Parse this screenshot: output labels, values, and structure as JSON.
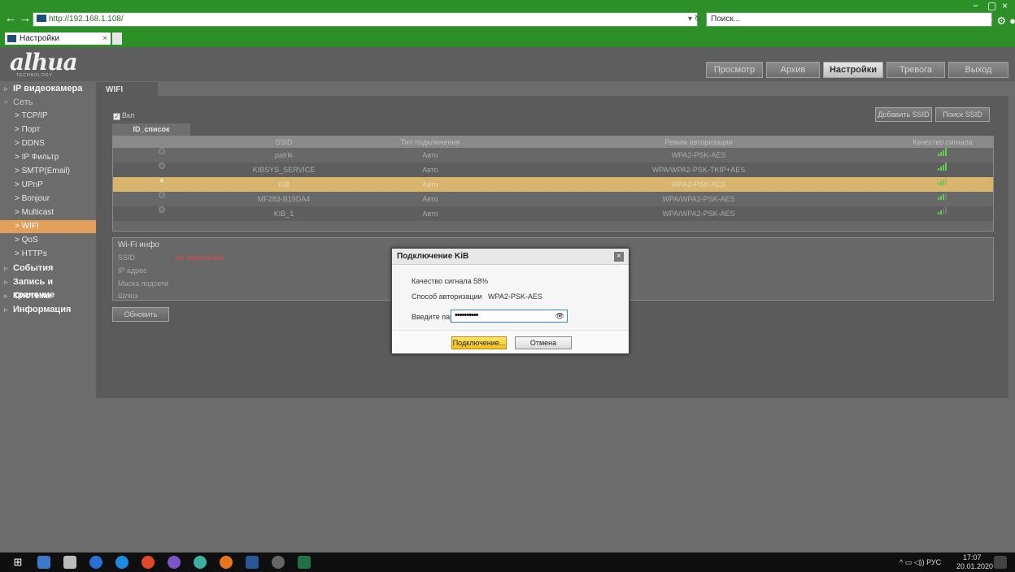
{
  "browser": {
    "url": "http://192.168.1.108/",
    "search_placeholder": "Поиск...",
    "tab_title": "Настройки",
    "tab_close": "×",
    "back_icon": "←",
    "forward_icon": "→",
    "refresh_icon": "▾ ↻",
    "search_dd_icon": "⌕▾",
    "toolbar_icons": "⌂★⚙●",
    "win_min": "−",
    "win_max": "▢",
    "win_close": "×"
  },
  "app": {
    "logo": "alhua",
    "logo_sub": "TECHNOLOGY",
    "nav": [
      {
        "label": "Просмотр"
      },
      {
        "label": "Архив"
      },
      {
        "label": "Настройки"
      },
      {
        "label": "Тревога"
      },
      {
        "label": "Выход"
      }
    ]
  },
  "sidebar": {
    "items": [
      {
        "label": "IP видеокамера"
      },
      {
        "label": "Сеть"
      },
      {
        "label": "> TCP/IP"
      },
      {
        "label": "> Порт"
      },
      {
        "label": "> DDNS"
      },
      {
        "label": "> IP Фильтр"
      },
      {
        "label": "> SMTP(Email)"
      },
      {
        "label": "> UPnP"
      },
      {
        "label": "> Bonjour"
      },
      {
        "label": "> Multicast"
      },
      {
        "label": "> WIFI"
      },
      {
        "label": "> QoS"
      },
      {
        "label": "> HTTPs"
      },
      {
        "label": "События"
      },
      {
        "label": "Запись и хранение"
      },
      {
        "label": "Система"
      },
      {
        "label": "Информация"
      }
    ]
  },
  "page": {
    "tab": "WIFI",
    "enable_label": "Вкл",
    "enable_check": "✓",
    "add_ssid": "Добавить SSID",
    "search_ssid": "Поиск SSID",
    "list_tab": "ID_список",
    "columns": [
      "SSID",
      "Тип подключения",
      "Режим авторизации",
      "Качество сигнала"
    ],
    "rows": [
      {
        "ssid": "patrik",
        "type": "Авто",
        "auth": "WPA2-PSK-AES"
      },
      {
        "ssid": "KIBSYS_SERVICE",
        "type": "Авто",
        "auth": "WPA/WPA2-PSK-TKIP+AES"
      },
      {
        "ssid": "KiB",
        "type": "Авто",
        "auth": "WPA2-PSK-AES"
      },
      {
        "ssid": "MF283-B19DA4",
        "type": "Авто",
        "auth": "WPA/WPA2-PSK-AES"
      },
      {
        "ssid": "KIB_1",
        "type": "Авто",
        "auth": "WPA/WPA2-PSK-AES"
      }
    ],
    "info": {
      "title": "Wi-Fi инфо",
      "ssid_label": "SSID",
      "ssid_value": "Не подключен",
      "ip_label": "IP адрес",
      "mask_label": "Маска подсети",
      "gw_label": "Шлюз"
    },
    "refresh": "Обновить"
  },
  "dialog": {
    "title": "Подключение KiB",
    "close": "×",
    "signal_label": "Качество сигнала",
    "signal_value": "58%",
    "auth_label": "Способ авторизации",
    "auth_value": "WPA2-PSK-AES",
    "password_label": "Введите пароль",
    "password_value": "••••••••••",
    "eye_icon": "👁",
    "connect": "Подключение...",
    "cancel": "Отмена"
  },
  "taskbar": {
    "start_icon": "⊞",
    "tray": "^ ▭ ◁)) РУС",
    "time": "17:07",
    "date": "20.01.2020"
  },
  "colors": {
    "browser_green": "#2d8f28",
    "selected_menu": "#e3a05a",
    "selected_row": "#d8b56e",
    "signal_green": "#5fcf4e",
    "error_red": "#e04a4a"
  }
}
